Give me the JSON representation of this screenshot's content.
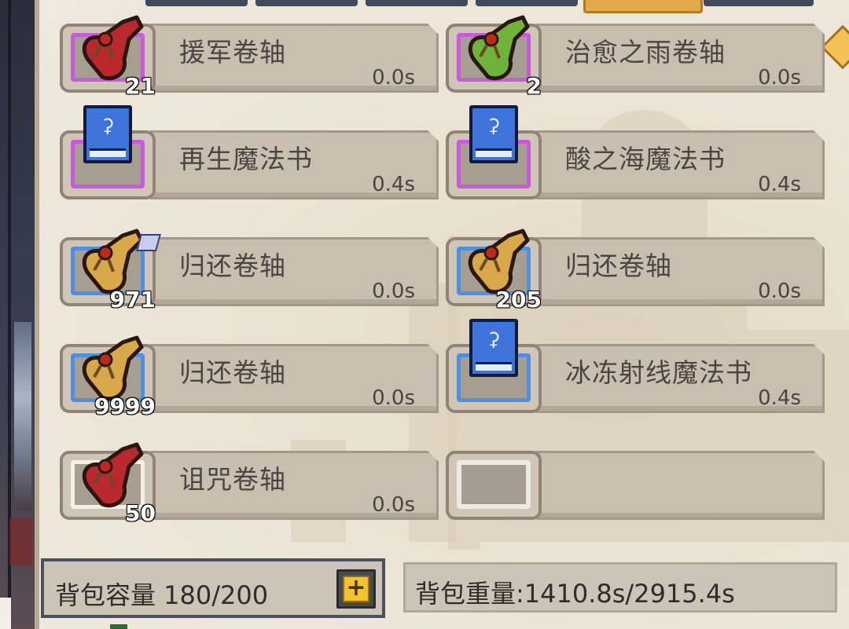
{
  "items": [
    {
      "name": "援军卷轴",
      "time": "0.0s",
      "count": "21",
      "icon": "red-scroll-icon",
      "rarity": "purple"
    },
    {
      "name": "治愈之雨卷轴",
      "time": "0.0s",
      "count": "2",
      "icon": "green-scroll-icon",
      "rarity": "purple"
    },
    {
      "name": "再生魔法书",
      "time": "0.4s",
      "count": "",
      "icon": "blue-spellbook-icon",
      "rarity": "purple"
    },
    {
      "name": "酸之海魔法书",
      "time": "0.4s",
      "count": "",
      "icon": "blue-spellbook-icon",
      "rarity": "purple"
    },
    {
      "name": "归还卷轴",
      "time": "0.0s",
      "count": "971",
      "icon": "gold-scroll-icon",
      "rarity": "blue"
    },
    {
      "name": "归还卷轴",
      "time": "0.0s",
      "count": "205",
      "icon": "gold-scroll-icon",
      "rarity": "blue"
    },
    {
      "name": "归还卷轴",
      "time": "0.0s",
      "count": "9999",
      "icon": "gold-scroll-icon",
      "rarity": "blue"
    },
    {
      "name": "冰冻射线魔法书",
      "time": "0.4s",
      "count": "",
      "icon": "blue-spellbook-icon",
      "rarity": "blue"
    },
    {
      "name": "诅咒卷轴",
      "time": "0.0s",
      "count": "50",
      "icon": "red-scroll-icon",
      "rarity": "white"
    },
    {
      "name": "",
      "time": "",
      "count": "",
      "icon": "",
      "rarity": "empty"
    }
  ],
  "footer": {
    "capacity_text": "背包容量 180/200",
    "weight_text": "背包重量:1410.8s/2915.4s"
  },
  "colors": {
    "purple_frame": "#c75bd9",
    "blue_frame": "#4e8fe0",
    "plus_button": "#f2c331"
  }
}
